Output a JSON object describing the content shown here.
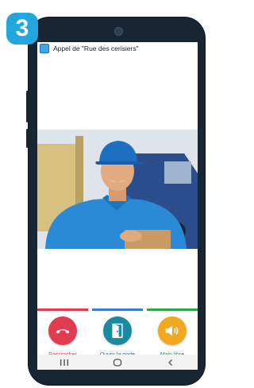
{
  "step": {
    "number": "3"
  },
  "header": {
    "title": "Appel de \"Rue des cerisiers\""
  },
  "actions": [
    {
      "label": "Raccrocher",
      "color": "#e23b4f",
      "icon": "hang-up-phone-icon"
    },
    {
      "label": "Ouvrir la porte",
      "color": "#1b8aa0",
      "icon": "door-icon"
    },
    {
      "label": "Main libre",
      "color": "#f0a820",
      "icon": "speaker-icon"
    }
  ],
  "accent_colors": {
    "hangup_bar": "#e23b4f",
    "door_bar": "#3f7dd1",
    "speaker_bar": "#2ea44f",
    "badge": "#22a7dc",
    "phone_body": "#182533"
  },
  "navbar": {
    "icons": [
      "recent-apps-icon",
      "home-icon",
      "back-icon"
    ]
  }
}
